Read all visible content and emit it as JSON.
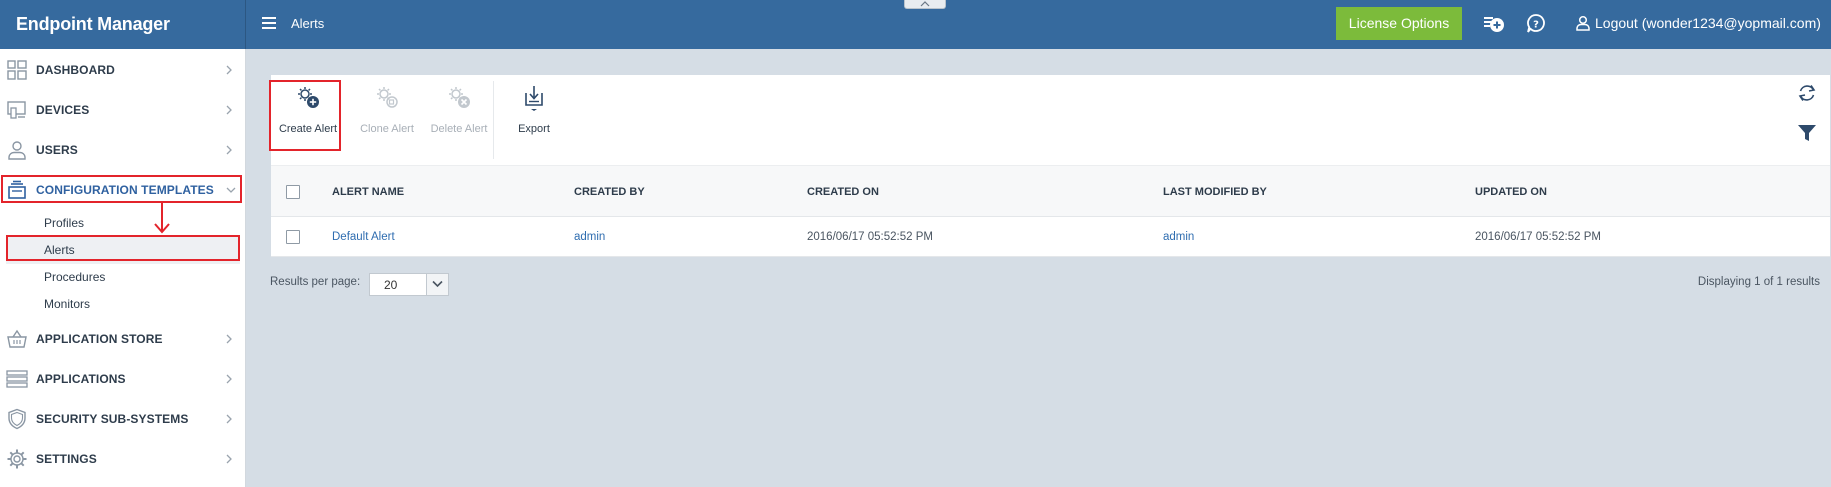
{
  "app": {
    "title": "Endpoint Manager"
  },
  "header": {
    "breadcrumb": "Alerts",
    "license_button": "License Options",
    "logout_label": "Logout (wonder1234@yopmail.com)"
  },
  "sidebar": {
    "items": [
      {
        "label": "DASHBOARD",
        "icon": "dashboard-grid-icon"
      },
      {
        "label": "DEVICES",
        "icon": "devices-icon"
      },
      {
        "label": "USERS",
        "icon": "user-icon"
      },
      {
        "label": "CONFIGURATION TEMPLATES",
        "icon": "templates-icon",
        "expanded": true
      },
      {
        "label": "APPLICATION STORE",
        "icon": "basket-icon"
      },
      {
        "label": "APPLICATIONS",
        "icon": "applications-icon"
      },
      {
        "label": "SECURITY SUB-SYSTEMS",
        "icon": "shield-icon"
      },
      {
        "label": "SETTINGS",
        "icon": "gear-icon"
      }
    ],
    "sub_items": [
      {
        "label": "Profiles"
      },
      {
        "label": "Alerts",
        "selected": true
      },
      {
        "label": "Procedures"
      },
      {
        "label": "Monitors"
      }
    ]
  },
  "toolbar": {
    "create_label": "Create Alert",
    "clone_label": "Clone Alert",
    "delete_label": "Delete Alert",
    "export_label": "Export"
  },
  "table": {
    "columns": [
      "ALERT NAME",
      "CREATED BY",
      "CREATED ON",
      "LAST MODIFIED BY",
      "UPDATED ON"
    ],
    "rows": [
      {
        "alert_name": "Default Alert",
        "created_by": "admin",
        "created_on": "2016/06/17 05:52:52 PM",
        "last_modified_by": "admin",
        "updated_on": "2016/06/17 05:52:52 PM"
      }
    ]
  },
  "footer": {
    "results_per_page_label": "Results per page:",
    "results_per_page_value": "20",
    "displaying": "Displaying 1 of 1 results"
  },
  "colors": {
    "topbar": "#366a9e",
    "license_button": "#7cbb3b",
    "highlight": "#e3242b",
    "link": "#2f6db0"
  }
}
